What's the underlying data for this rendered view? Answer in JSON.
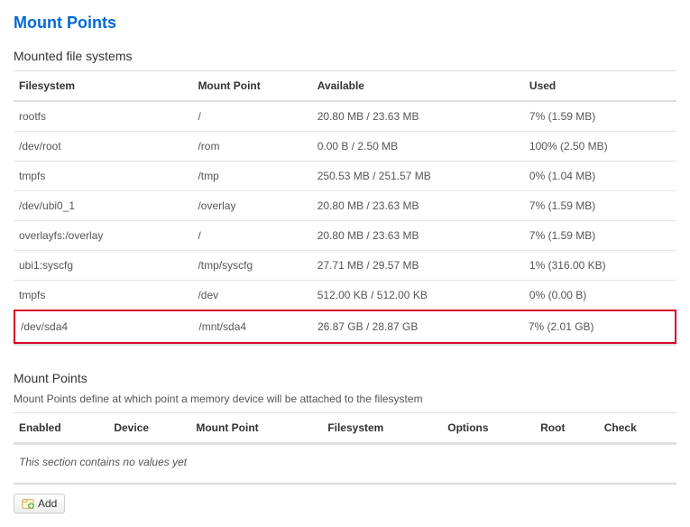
{
  "page_title": "Mount Points",
  "mounted_section": {
    "legend": "Mounted file systems",
    "columns": [
      "Filesystem",
      "Mount Point",
      "Available",
      "Used"
    ],
    "rows": [
      {
        "fs": "rootfs",
        "mp": "/",
        "avail": "20.80 MB / 23.63 MB",
        "used": "7% (1.59 MB)",
        "highlight": false
      },
      {
        "fs": "/dev/root",
        "mp": "/rom",
        "avail": "0.00 B / 2.50 MB",
        "used": "100% (2.50 MB)",
        "highlight": false
      },
      {
        "fs": "tmpfs",
        "mp": "/tmp",
        "avail": "250.53 MB / 251.57 MB",
        "used": "0% (1.04 MB)",
        "highlight": false
      },
      {
        "fs": "/dev/ubi0_1",
        "mp": "/overlay",
        "avail": "20.80 MB / 23.63 MB",
        "used": "7% (1.59 MB)",
        "highlight": false
      },
      {
        "fs": "overlayfs:/overlay",
        "mp": "/",
        "avail": "20.80 MB / 23.63 MB",
        "used": "7% (1.59 MB)",
        "highlight": false
      },
      {
        "fs": "ubi1:syscfg",
        "mp": "/tmp/syscfg",
        "avail": "27.71 MB / 29.57 MB",
        "used": "1% (316.00 KB)",
        "highlight": false
      },
      {
        "fs": "tmpfs",
        "mp": "/dev",
        "avail": "512.00 KB / 512.00 KB",
        "used": "0% (0.00 B)",
        "highlight": false
      },
      {
        "fs": "/dev/sda4",
        "mp": "/mnt/sda4",
        "avail": "26.87 GB / 28.87 GB",
        "used": "7% (2.01 GB)",
        "highlight": true
      }
    ]
  },
  "mountpoints_section": {
    "legend": "Mount Points",
    "description": "Mount Points define at which point a memory device will be attached to the filesystem",
    "columns": [
      "Enabled",
      "Device",
      "Mount Point",
      "Filesystem",
      "Options",
      "Root",
      "Check"
    ],
    "empty_text": "This section contains no values yet",
    "add_label": "Add"
  }
}
